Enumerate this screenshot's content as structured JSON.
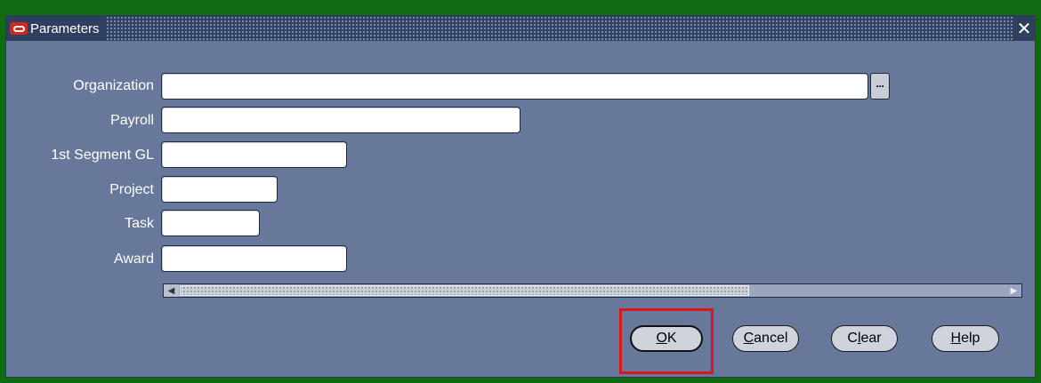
{
  "window": {
    "title": "Parameters",
    "close_glyph": "✕"
  },
  "icons": {
    "logo": "oracle-logo-icon",
    "close": "close-icon",
    "lov": "list-of-values-icon"
  },
  "fields": [
    {
      "label": "Organization",
      "value": ""
    },
    {
      "label": "Payroll",
      "value": ""
    },
    {
      "label": "1st Segment GL",
      "value": ""
    },
    {
      "label": "Project",
      "value": ""
    },
    {
      "label": "Task",
      "value": ""
    },
    {
      "label": "Award",
      "value": ""
    }
  ],
  "lov_glyph": "···",
  "scrollbar": {
    "left_arrow": "◀",
    "right_arrow": "▶"
  },
  "buttons": {
    "ok": {
      "pre": "",
      "mnemonic": "O",
      "post": "K"
    },
    "cancel": {
      "pre": "",
      "mnemonic": "C",
      "post": "ancel"
    },
    "clear": {
      "pre": "C",
      "mnemonic": "l",
      "post": "ear"
    },
    "help": {
      "pre": "",
      "mnemonic": "H",
      "post": "elp"
    }
  },
  "colors": {
    "window_bg": "#67789a",
    "titlebar": "#2f3f5f",
    "highlight": "#e0141b",
    "desktop": "#0f6a12"
  }
}
